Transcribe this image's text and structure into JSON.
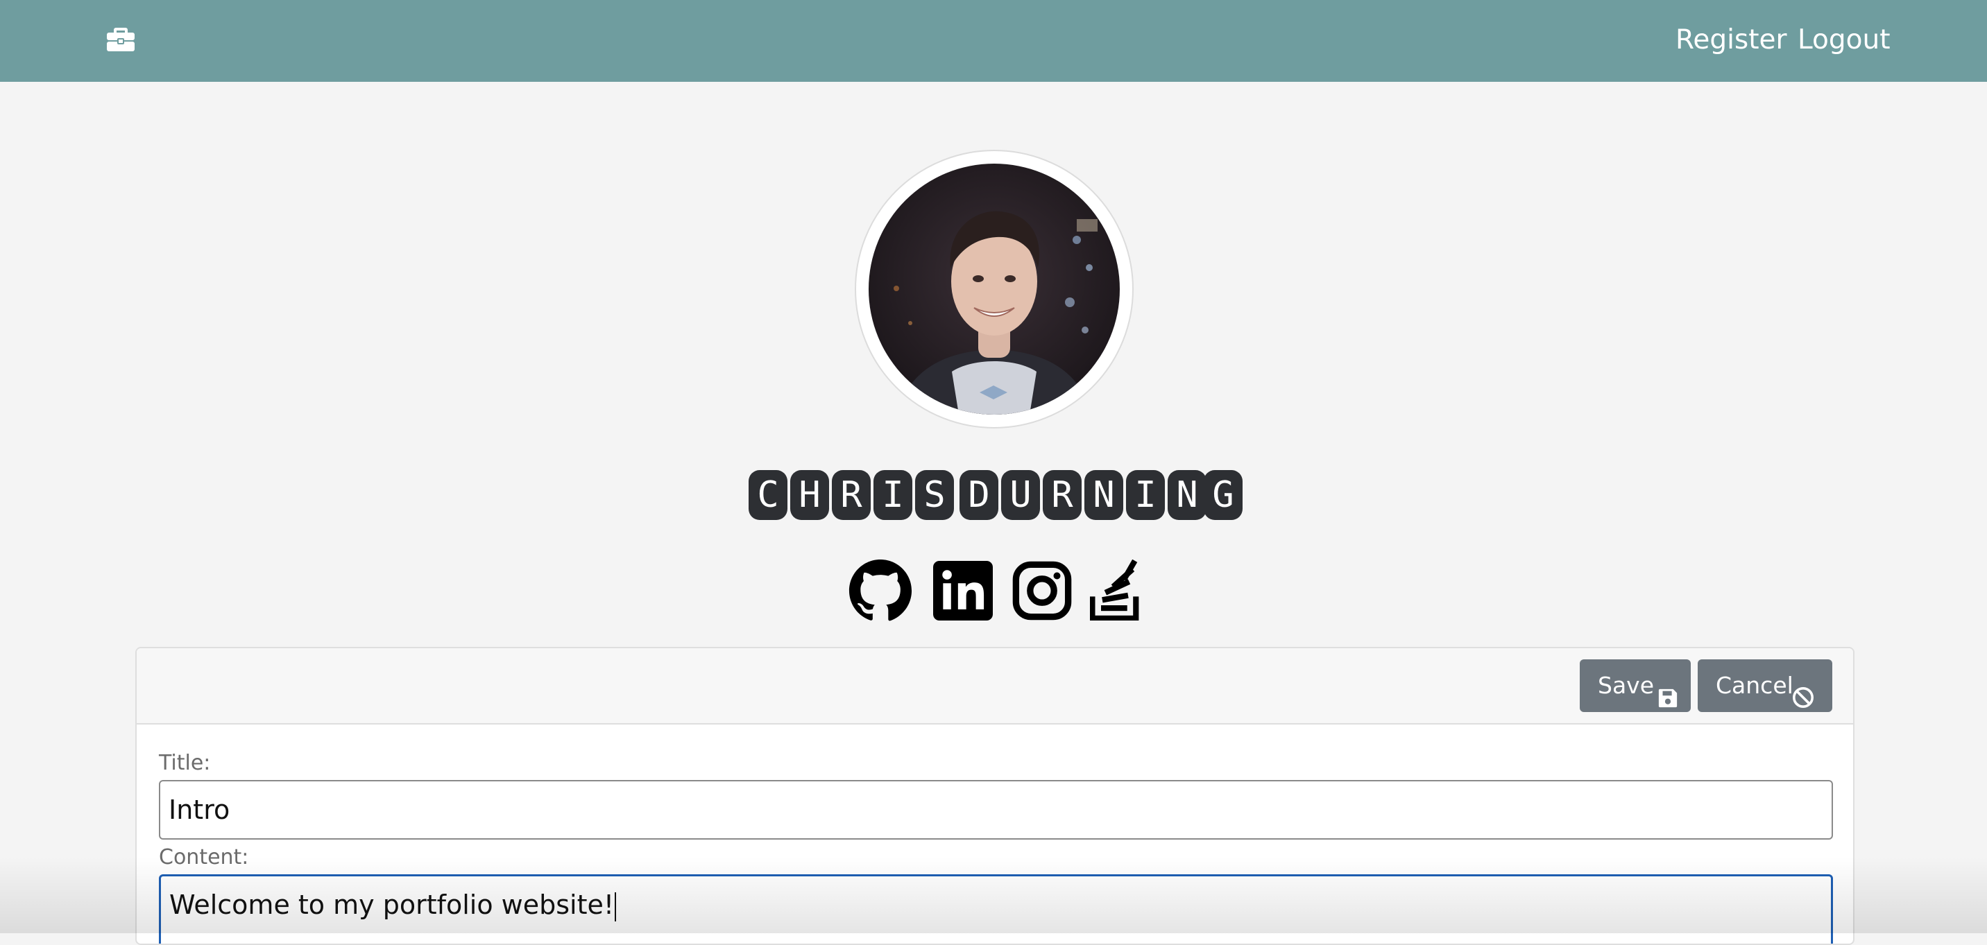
{
  "navbar": {
    "brand_icon": "briefcase-icon",
    "links": [
      {
        "label": "Register"
      },
      {
        "label": "Logout"
      }
    ]
  },
  "profile": {
    "avatar": "profile-photo",
    "name_letters": [
      "C",
      "H",
      "R",
      "I",
      "S",
      "D",
      "U",
      "R",
      "N",
      "I",
      "N",
      "G"
    ],
    "social_icons": [
      "github-icon",
      "linkedin-icon",
      "instagram-icon",
      "stackoverflow-icon"
    ]
  },
  "editor": {
    "save_label": "Save",
    "save_icon": "floppy-disk-icon",
    "cancel_label": "Cancel",
    "cancel_icon": "ban-icon",
    "title_label": "Title:",
    "title_value": "Intro",
    "content_label": "Content:",
    "content_value": "Welcome to my portfolio website!"
  },
  "colors": {
    "navbar": "#6f9d9f",
    "button": "#6c757d",
    "focus": "#1e5fb4"
  }
}
